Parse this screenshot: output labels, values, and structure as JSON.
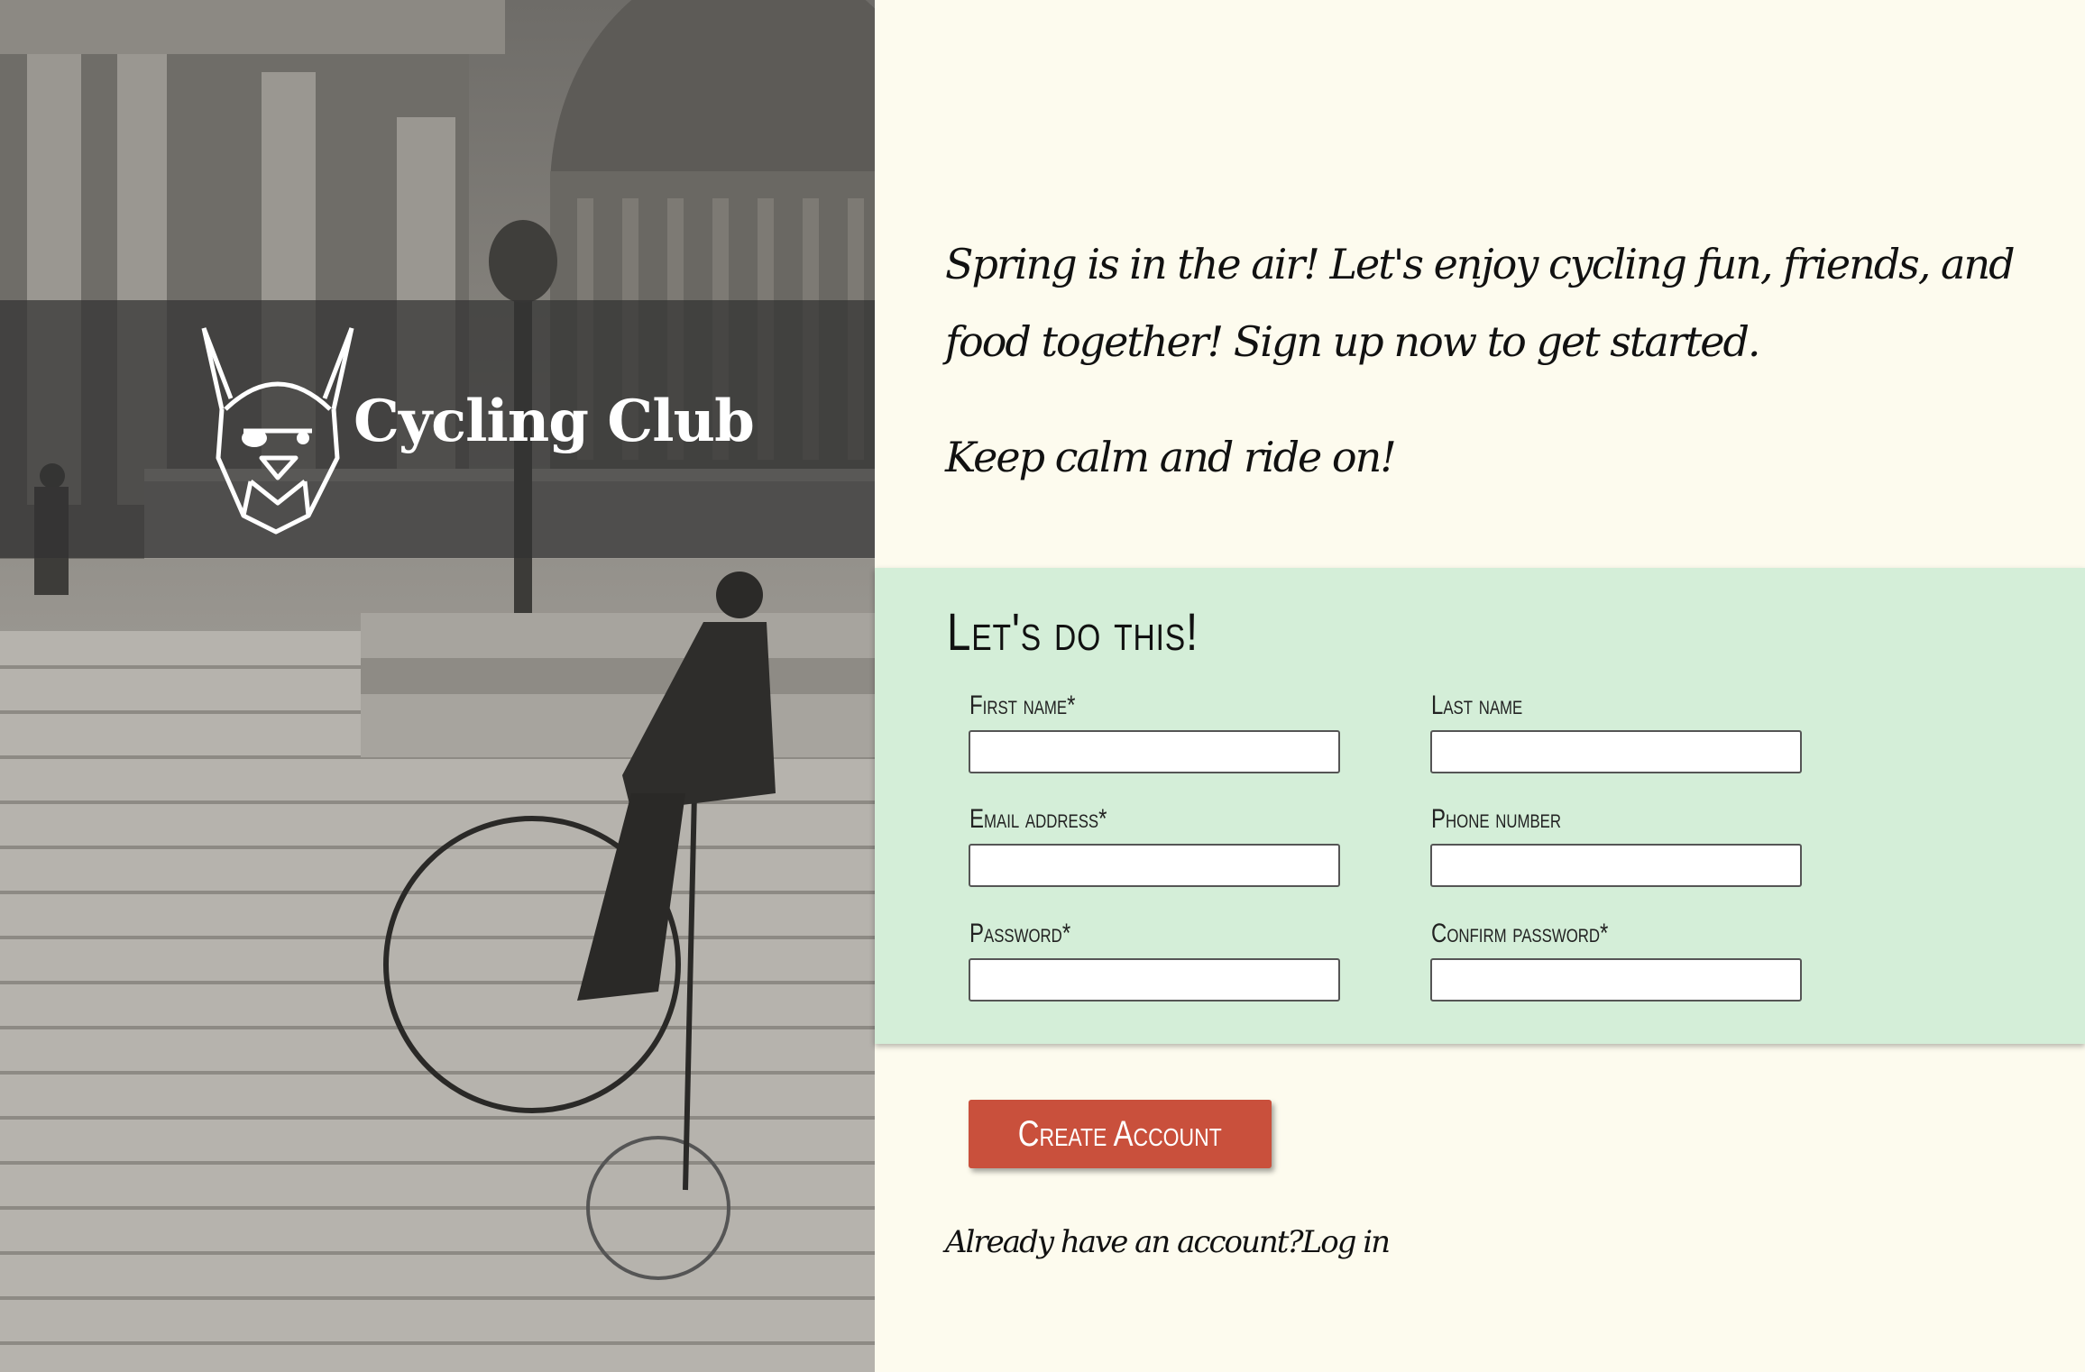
{
  "brand": {
    "name": "Cycling Club",
    "logo_icon": "bulldog-viking-helmet-icon"
  },
  "intro": {
    "paragraph": "Spring is in the air! Let's enjoy cycling fun, friends, and food together! Sign up now to get started.",
    "motto": "Keep calm and ride on!"
  },
  "form": {
    "title": "Let's do this!",
    "fields": {
      "first_name": {
        "label": "First name*",
        "value": "",
        "placeholder": ""
      },
      "last_name": {
        "label": "Last name",
        "value": "",
        "placeholder": ""
      },
      "email": {
        "label": "Email address*",
        "value": "",
        "placeholder": ""
      },
      "phone": {
        "label": "Phone number",
        "value": "",
        "placeholder": ""
      },
      "password": {
        "label": "Password*",
        "value": "",
        "placeholder": ""
      },
      "confirm_password": {
        "label": "Confirm password*",
        "value": "",
        "placeholder": ""
      }
    },
    "submit_label": "Create Account"
  },
  "login": {
    "prompt": "Already have an account?",
    "link_label": "Log in"
  },
  "colors": {
    "page_bg": "#fdfbee",
    "form_bg": "#d4eed8",
    "button": "#c9503c",
    "logo_band": "#323232"
  }
}
